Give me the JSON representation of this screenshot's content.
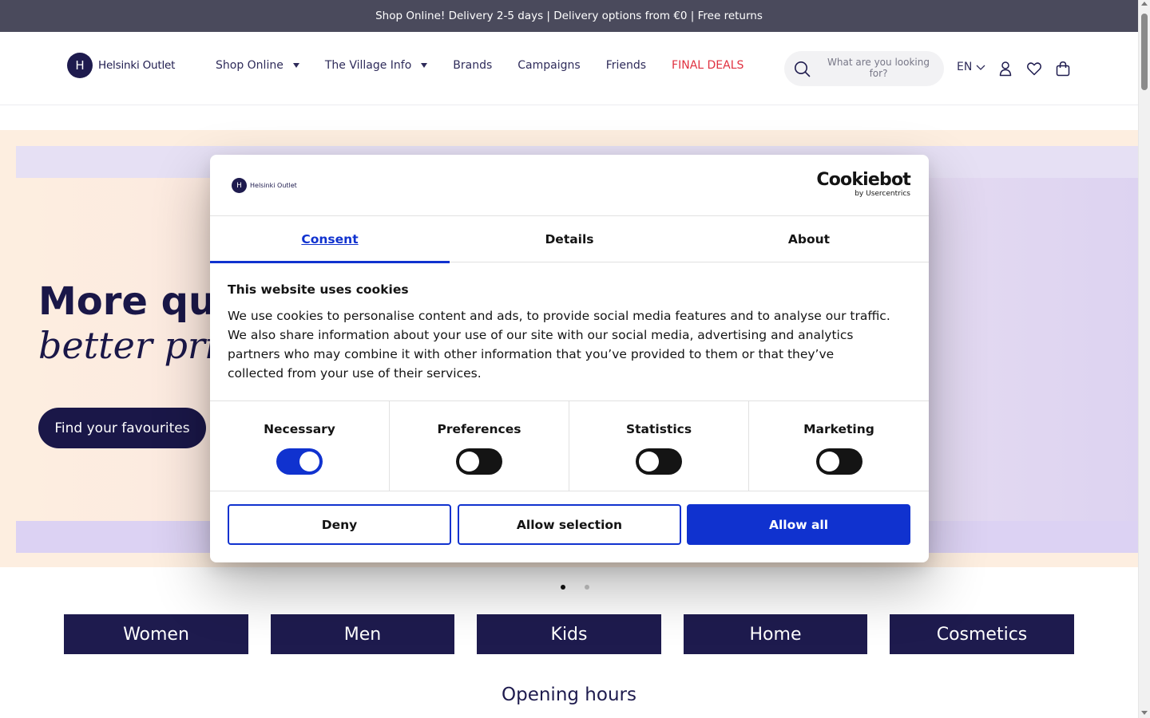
{
  "announcement": "Shop Online! Delivery 2-5 days | Delivery options from €0 | Free returns",
  "header": {
    "logo_letter": "H",
    "logo_text": "Helsinki Outlet",
    "nav": [
      {
        "label": "Shop Online",
        "dropdown": true
      },
      {
        "label": "The Village Info",
        "dropdown": true
      },
      {
        "label": "Brands",
        "dropdown": false
      },
      {
        "label": "Campaigns",
        "dropdown": false
      },
      {
        "label": "Friends",
        "dropdown": false
      },
      {
        "label": "FINAL DEALS",
        "dropdown": false
      }
    ],
    "search_placeholder": "What are you looking for?",
    "language": "EN",
    "icons": [
      "search-icon",
      "chevron-down-icon",
      "user-icon",
      "heart-icon",
      "shopping-bag-icon"
    ]
  },
  "hero": {
    "title_line1": "More qua",
    "title_line2": "better price.",
    "button_label": "Find your favourites",
    "slides": 2,
    "active_slide": 1
  },
  "categories": [
    "Women",
    "Men",
    "Kids",
    "Home",
    "Cosmetics"
  ],
  "opening_hours_title": "Opening hours",
  "cookie_dialog": {
    "logo_letter": "H",
    "logo_text": "Helsinki Outlet",
    "brand_name": "Cookiebot",
    "brand_sub": "by Usercentrics",
    "tabs": [
      {
        "label": "Consent",
        "active": true
      },
      {
        "label": "Details",
        "active": false
      },
      {
        "label": "About",
        "active": false
      }
    ],
    "title": "This website uses cookies",
    "body": "We use cookies to personalise content and ads, to provide social media features and to analyse our traffic. We also share information about your use of our site with our social media, advertising and analytics partners who may combine it with other information that you’ve provided to them or that they’ve collected from your use of their services.",
    "toggles": [
      {
        "label": "Necessary",
        "on": true
      },
      {
        "label": "Preferences",
        "on": false
      },
      {
        "label": "Statistics",
        "on": false
      },
      {
        "label": "Marketing",
        "on": false
      }
    ],
    "buttons": {
      "deny": "Deny",
      "allow_selection": "Allow selection",
      "allow_all": "Allow all"
    }
  },
  "colors": {
    "brand_navy": "#1e1b4e",
    "accent_blue": "#1032cf",
    "deal_red": "#e03140",
    "announce_bg": "#4a4a5c"
  }
}
